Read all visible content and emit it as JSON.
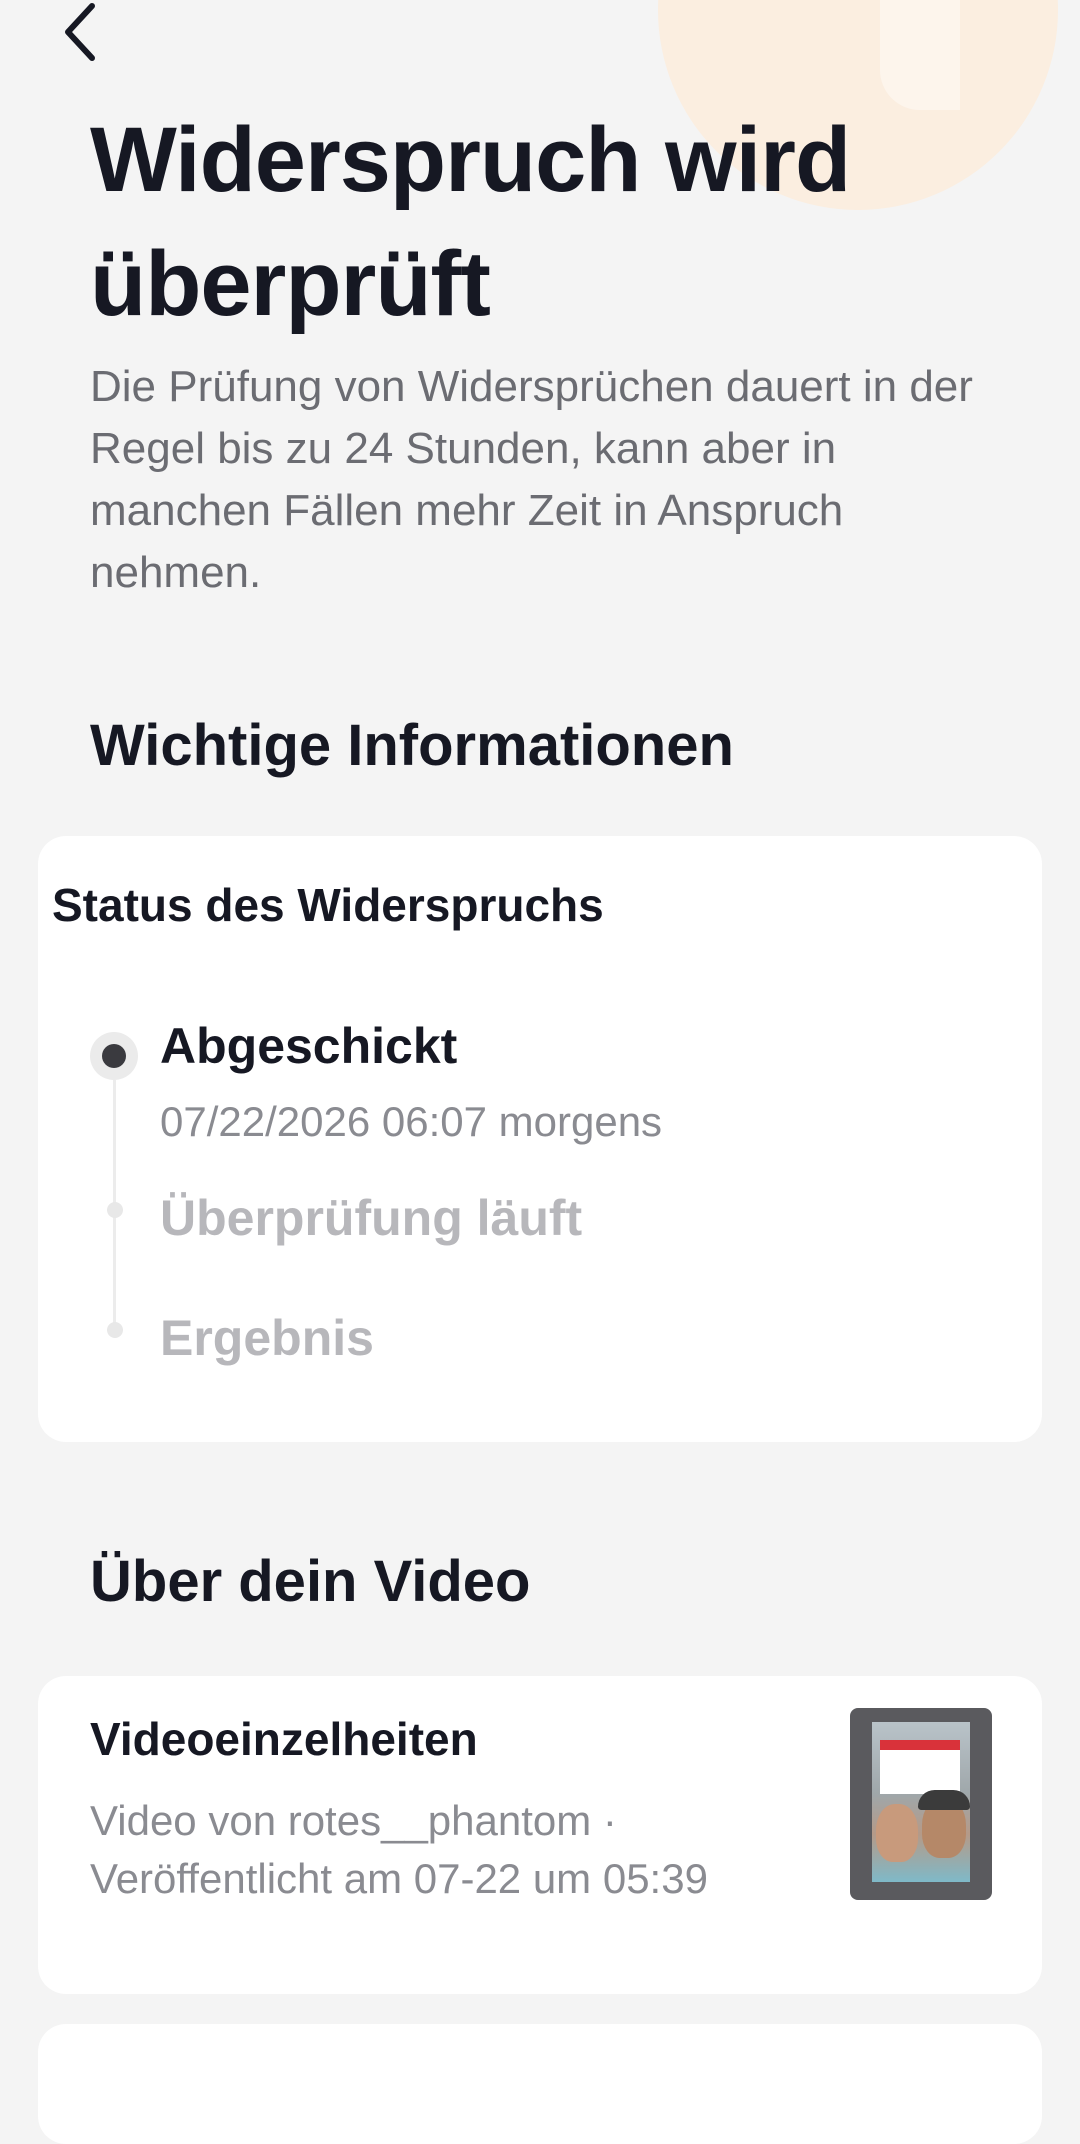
{
  "header": {
    "title": "Widerspruch wird überprüft",
    "description": "Die Prüfung von Widersprüchen dauert in der Regel bis zu 24 Stunden, kann aber in manchen Fällen mehr Zeit in Anspruch nehmen.",
    "back_icon": "chevron-left-icon"
  },
  "info_section": {
    "heading": "Wichtige Informationen",
    "status_card": {
      "title": "Status des Widerspruchs",
      "steps": [
        {
          "label": "Abgeschickt",
          "time": "07/22/2026 06:07 morgens",
          "state": "done"
        },
        {
          "label": "Überprüfung läuft",
          "state": "pending"
        },
        {
          "label": "Ergebnis",
          "state": "pending"
        }
      ]
    }
  },
  "video_section": {
    "heading": "Über dein Video",
    "details_card": {
      "title": "Videoeinzelheiten",
      "description": "Video von rotes__phantom · Veröffentlicht am 07-22 um 05:39",
      "thumbnail_icon": "video-thumbnail"
    }
  },
  "colors": {
    "background": "#f4f4f4",
    "card": "#ffffff",
    "text_primary": "#161823",
    "text_secondary": "#8a8b91",
    "text_pending": "#b7b7bb",
    "decor_accent": "#fbeee0"
  }
}
